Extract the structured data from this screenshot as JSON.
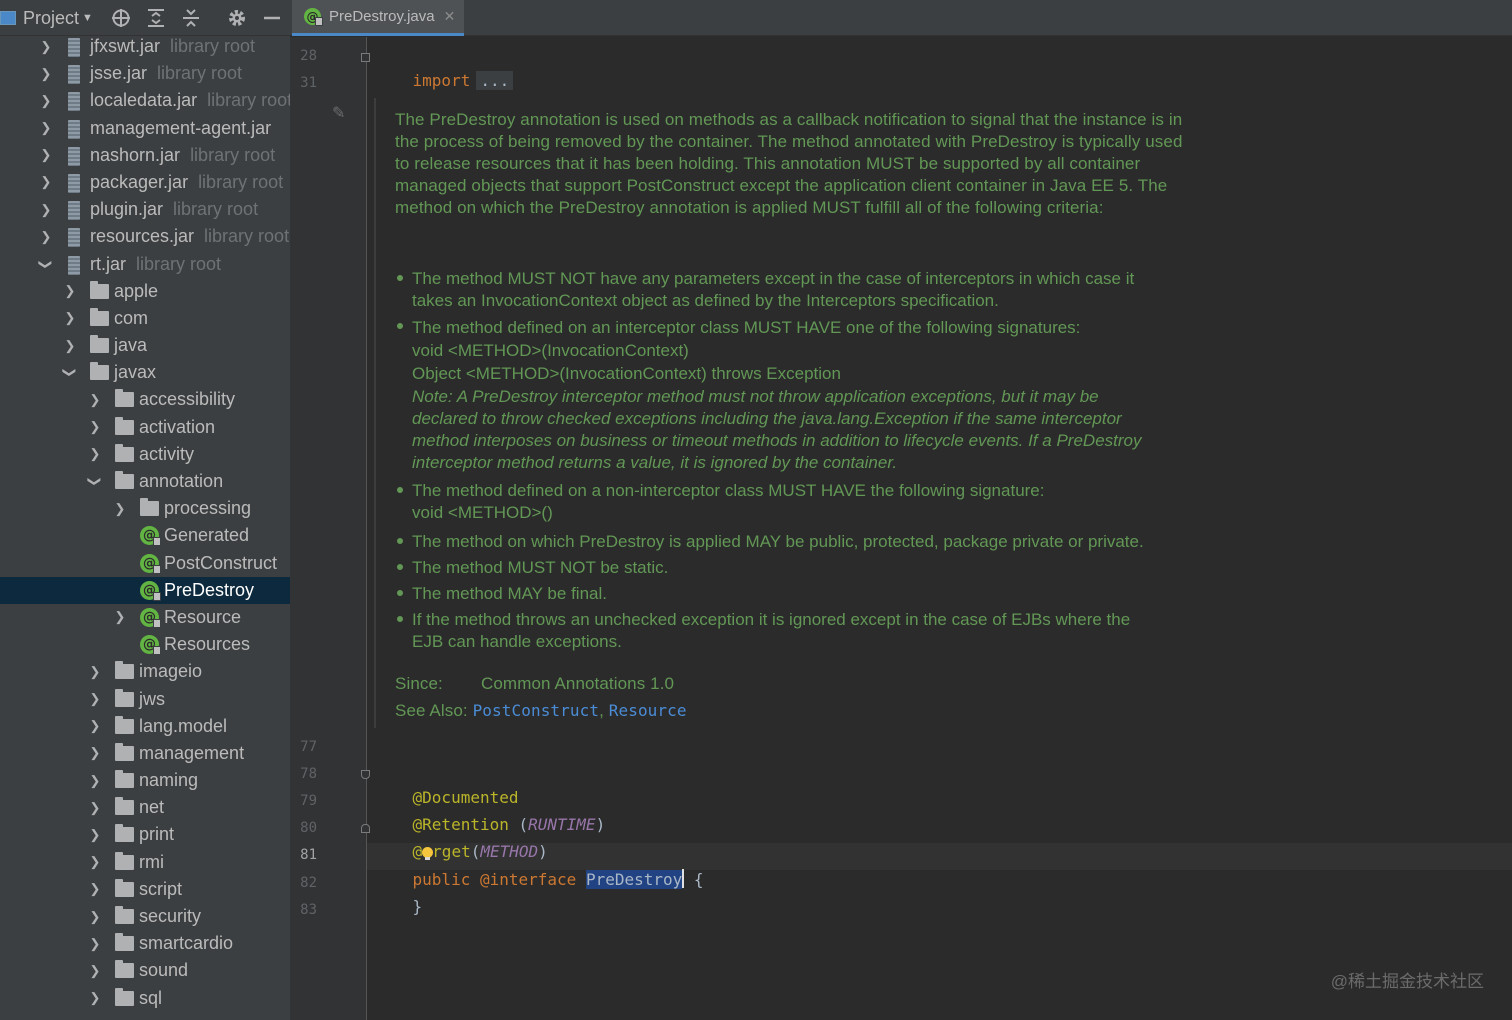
{
  "sidebar": {
    "title": "Project",
    "tree": [
      {
        "name": "jfxswt.jar",
        "sub": "library root",
        "icon": "jar",
        "depth": 0,
        "arrow": "closed"
      },
      {
        "name": "jsse.jar",
        "sub": "library root",
        "icon": "jar",
        "depth": 0,
        "arrow": "closed"
      },
      {
        "name": "localedata.jar",
        "sub": "library root",
        "icon": "jar",
        "depth": 0,
        "arrow": "closed"
      },
      {
        "name": "management-agent.jar",
        "sub": "",
        "icon": "jar",
        "depth": 0,
        "arrow": "closed"
      },
      {
        "name": "nashorn.jar",
        "sub": "library root",
        "icon": "jar",
        "depth": 0,
        "arrow": "closed"
      },
      {
        "name": "packager.jar",
        "sub": "library root",
        "icon": "jar",
        "depth": 0,
        "arrow": "closed"
      },
      {
        "name": "plugin.jar",
        "sub": "library root",
        "icon": "jar",
        "depth": 0,
        "arrow": "closed"
      },
      {
        "name": "resources.jar",
        "sub": "library root",
        "icon": "jar",
        "depth": 0,
        "arrow": "closed"
      },
      {
        "name": "rt.jar",
        "sub": "library root",
        "icon": "jar",
        "depth": 0,
        "arrow": "open"
      },
      {
        "name": "apple",
        "sub": "",
        "icon": "folder",
        "depth": 1,
        "arrow": "closed"
      },
      {
        "name": "com",
        "sub": "",
        "icon": "folder",
        "depth": 1,
        "arrow": "closed"
      },
      {
        "name": "java",
        "sub": "",
        "icon": "folder",
        "depth": 1,
        "arrow": "closed"
      },
      {
        "name": "javax",
        "sub": "",
        "icon": "folder",
        "depth": 1,
        "arrow": "open"
      },
      {
        "name": "accessibility",
        "sub": "",
        "icon": "folder",
        "depth": 2,
        "arrow": "closed"
      },
      {
        "name": "activation",
        "sub": "",
        "icon": "folder",
        "depth": 2,
        "arrow": "closed"
      },
      {
        "name": "activity",
        "sub": "",
        "icon": "folder",
        "depth": 2,
        "arrow": "closed"
      },
      {
        "name": "annotation",
        "sub": "",
        "icon": "folder",
        "depth": 2,
        "arrow": "open"
      },
      {
        "name": "processing",
        "sub": "",
        "icon": "folder",
        "depth": 3,
        "arrow": "closed"
      },
      {
        "name": "Generated",
        "sub": "",
        "icon": "annotation",
        "depth": 3,
        "arrow": "none"
      },
      {
        "name": "PostConstruct",
        "sub": "",
        "icon": "annotation",
        "depth": 3,
        "arrow": "none"
      },
      {
        "name": "PreDestroy",
        "sub": "",
        "icon": "annotation",
        "depth": 3,
        "arrow": "none",
        "selected": true
      },
      {
        "name": "Resource",
        "sub": "",
        "icon": "annotation",
        "depth": 3,
        "arrow": "closed"
      },
      {
        "name": "Resources",
        "sub": "",
        "icon": "annotation",
        "depth": 3,
        "arrow": "none"
      },
      {
        "name": "imageio",
        "sub": "",
        "icon": "folder",
        "depth": 2,
        "arrow": "closed"
      },
      {
        "name": "jws",
        "sub": "",
        "icon": "folder",
        "depth": 2,
        "arrow": "closed"
      },
      {
        "name": "lang.model",
        "sub": "",
        "icon": "folder",
        "depth": 2,
        "arrow": "closed"
      },
      {
        "name": "management",
        "sub": "",
        "icon": "folder",
        "depth": 2,
        "arrow": "closed"
      },
      {
        "name": "naming",
        "sub": "",
        "icon": "folder",
        "depth": 2,
        "arrow": "closed"
      },
      {
        "name": "net",
        "sub": "",
        "icon": "folder",
        "depth": 2,
        "arrow": "closed"
      },
      {
        "name": "print",
        "sub": "",
        "icon": "folder",
        "depth": 2,
        "arrow": "closed"
      },
      {
        "name": "rmi",
        "sub": "",
        "icon": "folder",
        "depth": 2,
        "arrow": "closed"
      },
      {
        "name": "script",
        "sub": "",
        "icon": "folder",
        "depth": 2,
        "arrow": "closed"
      },
      {
        "name": "security",
        "sub": "",
        "icon": "folder",
        "depth": 2,
        "arrow": "closed"
      },
      {
        "name": "smartcardio",
        "sub": "",
        "icon": "folder",
        "depth": 2,
        "arrow": "closed"
      },
      {
        "name": "sound",
        "sub": "",
        "icon": "folder",
        "depth": 2,
        "arrow": "closed"
      },
      {
        "name": "sql",
        "sub": "",
        "icon": "folder",
        "depth": 2,
        "arrow": "closed"
      }
    ]
  },
  "editor": {
    "tab_title": "PreDestroy.java",
    "line_numbers": {
      "import": "28",
      "after_import": "31",
      "l77": "77",
      "l78": "78",
      "l79": "79",
      "l80": "80",
      "l81": "81",
      "l82": "82",
      "l83": "83"
    },
    "code": {
      "import_kw": "import",
      "fold_placeholder": "...",
      "documented": "@Documented",
      "retention": "@Retention",
      "retention_arg": "RUNTIME",
      "target_a": "@",
      "target_b": "rget",
      "target_arg": "METHOD",
      "public_kw": "public",
      "interface_kw": "@interface",
      "class_name": "PreDestroy",
      "open_brace": "{",
      "close_brace": "}"
    },
    "doc": {
      "intro_lines": [
        "The PreDestroy annotation is used on methods as a callback notification to signal that the instance is in",
        "the process of being removed by the container. The method annotated with PreDestroy is typically used",
        "to release resources that it has been holding. This annotation MUST be supported by all container",
        "managed objects that support PostConstruct except the application client container in Java EE 5. The",
        "method on which the PreDestroy annotation is applied MUST fulfill all of the following criteria:"
      ],
      "b1": [
        "The method MUST NOT have any parameters except in the case of interceptors in which case it",
        "takes an InvocationContext object as defined by the Interceptors specification."
      ],
      "b2": [
        "The method defined on an interceptor class MUST HAVE one of the following signatures:",
        "void <METHOD>(InvocationContext)",
        "Object <METHOD>(InvocationContext) throws Exception"
      ],
      "note": [
        "Note: A PreDestroy interceptor method must not throw application exceptions, but it may be",
        "declared to throw checked exceptions including the java.lang.Exception if the same interceptor",
        "method interposes on business or timeout methods in addition to lifecycle events. If a PreDestroy",
        "interceptor method returns a value, it is ignored by the container."
      ],
      "b3": [
        "The method defined on a non-interceptor class MUST HAVE the following signature:",
        "void <METHOD>()"
      ],
      "b4": "The method on which PreDestroy is applied MAY be public, protected, package private or private.",
      "b5": "The method MUST NOT be static.",
      "b6": "The method MAY be final.",
      "b7": [
        "If the method throws an unchecked exception it is ignored except in the case of EJBs where the",
        "EJB can handle exceptions."
      ],
      "since_label": "Since:",
      "since_value": "Common Annotations 1.0",
      "see_also_label": "See Also:",
      "see_also_link1": "PostConstruct",
      "see_also_sep": ",",
      "see_also_link2": "Resource"
    }
  },
  "watermark": "@稀土掘金技术社区",
  "colors": {
    "keyword": "#cc7832",
    "annotation": "#bbb529",
    "doc": "#629755",
    "link": "#4a8cd6",
    "selection": "#0d293e"
  }
}
